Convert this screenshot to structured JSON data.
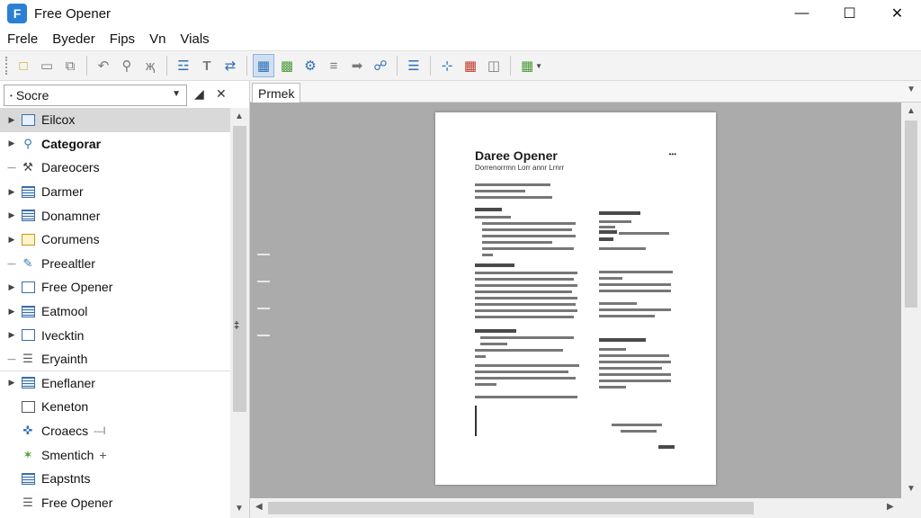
{
  "window": {
    "title": "Free Opener",
    "app_icon_glyph": "F",
    "controls": [
      "—",
      "☐",
      "✕"
    ]
  },
  "menu": [
    "Frele",
    "Byeder",
    "Fips",
    "Vn",
    "Vials"
  ],
  "toolbar": {
    "groups": [
      [
        "folder-open-icon",
        "new-document-icon",
        "copy-icon"
      ],
      [
        "undo-icon",
        "zoom-icon",
        "filter-icon"
      ],
      [
        "format-icon",
        "text-icon",
        "replace-icon"
      ],
      [
        "image-view-icon",
        "layout-icon",
        "tools-icon",
        "minus-icon",
        "arrow-icon",
        "link-icon"
      ],
      [
        "list-icon"
      ],
      [
        "crop-icon",
        "grid-icon",
        "find-icon"
      ],
      [
        "table-dropdown-icon"
      ]
    ],
    "active": "image-view-icon"
  },
  "source": {
    "label": "Socre"
  },
  "tree": [
    {
      "label": "Eilcox",
      "icon": "image-box-icon",
      "expandable": true,
      "selected": true
    },
    {
      "label": "Categorar",
      "icon": "nodes-icon",
      "expandable": true,
      "bold": true
    },
    {
      "label": "Dareocers",
      "icon": "tools-icon",
      "expandable": false
    },
    {
      "label": "Darmer",
      "icon": "document-icon",
      "expandable": true
    },
    {
      "label": "Donamner",
      "icon": "document-icon",
      "expandable": true
    },
    {
      "label": "Corumens",
      "icon": "folder-yellow-icon",
      "expandable": true
    },
    {
      "label": "Preealtler",
      "icon": "pen-icon",
      "expandable": false
    },
    {
      "label": "Free Opener",
      "icon": "window-icon",
      "expandable": true
    },
    {
      "label": "Eatmool",
      "icon": "sheet-icon",
      "expandable": true
    },
    {
      "label": "Ivecktin",
      "icon": "window-icon",
      "expandable": true
    },
    {
      "label": "Eryainth",
      "icon": "stack-icon",
      "expandable": false
    },
    {
      "label": "Eneflaner",
      "icon": "document-icon",
      "expandable": true
    },
    {
      "label": "Keneton",
      "icon": "page-icon",
      "expandable": false
    },
    {
      "label": "Croaecs",
      "icon": "bandage-icon",
      "expandable": false,
      "suffix": "-–l"
    },
    {
      "label": "Smentich",
      "icon": "graph-icon",
      "expandable": false,
      "suffix": "+"
    },
    {
      "label": "Eapstnts",
      "icon": "sheet-icon",
      "expandable": false
    },
    {
      "label": "Free Opener",
      "icon": "stack-icon",
      "expandable": false
    }
  ],
  "tab": {
    "label": "Prmek"
  },
  "document": {
    "title": "Daree Opener",
    "subtitle": "Dorrenorrmn Lorr annr Lrnrr",
    "mark": "•••"
  },
  "colors": {
    "accent": "#2b7fd4",
    "canvas": "#ababab",
    "selected_row": "#d9d9d9"
  }
}
